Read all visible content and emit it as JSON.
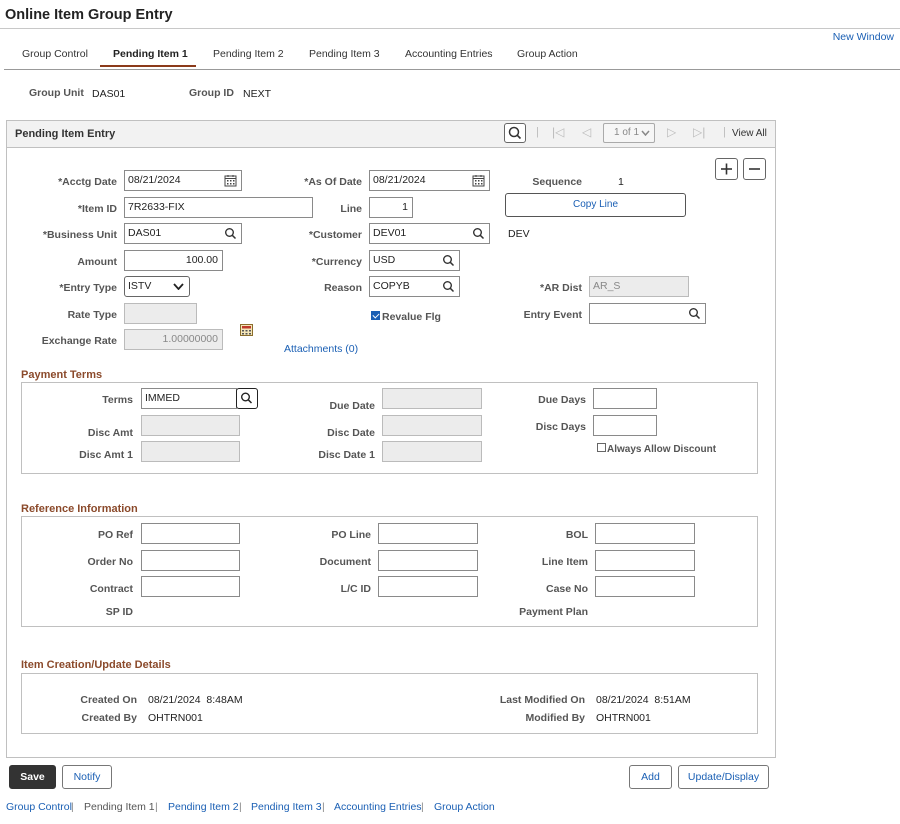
{
  "app": {
    "title": "Online Item Group Entry",
    "new_window": "New Window"
  },
  "tabs": [
    {
      "label": "Group Control"
    },
    {
      "label": "Pending Item 1"
    },
    {
      "label": "Pending Item 2"
    },
    {
      "label": "Pending Item 3"
    },
    {
      "label": "Accounting Entries"
    },
    {
      "label": "Group Action"
    }
  ],
  "header": {
    "group_unit_label": "Group Unit",
    "group_unit": "DAS01",
    "group_id_label": "Group ID",
    "group_id": "NEXT"
  },
  "pending": {
    "title": "Pending Item Entry",
    "pager": "1 of 1",
    "view_all": "View All",
    "acctg_date_label": "*Acctg Date",
    "acctg_date": "08/21/2024",
    "as_of_date_label": "*As Of Date",
    "as_of_date": "08/21/2024",
    "sequence_label": "Sequence",
    "sequence": "1",
    "item_id_label": "*Item ID",
    "item_id": "7R2633-FIX",
    "line_label": "Line",
    "line": "1",
    "copy_line": "Copy Line",
    "business_unit_label": "*Business Unit",
    "business_unit": "DAS01",
    "customer_label": "*Customer",
    "customer": "DEV01",
    "customer_name": "DEV",
    "amount_label": "Amount",
    "amount": "100.00",
    "currency_label": "*Currency",
    "currency": "USD",
    "entry_type_label": "*Entry Type",
    "entry_type": "ISTV",
    "reason_label": "Reason",
    "reason": "COPYB",
    "ar_dist_label": "*AR Dist",
    "ar_dist": "AR_S",
    "rate_type_label": "Rate Type",
    "rate_type": "",
    "revalue_flg_label": "Revalue Flg",
    "entry_event_label": "Entry Event",
    "entry_event": "",
    "exchange_rate_label": "Exchange Rate",
    "exchange_rate": "1.00000000",
    "attachments": "Attachments (0)"
  },
  "payment_terms": {
    "title": "Payment Terms",
    "terms_label": "Terms",
    "terms": "IMMED",
    "due_date_label": "Due Date",
    "due_days_label": "Due Days",
    "disc_amt_label": "Disc Amt",
    "disc_date_label": "Disc Date",
    "disc_days_label": "Disc Days",
    "disc_amt1_label": "Disc Amt 1",
    "disc_date1_label": "Disc Date 1",
    "always_allow_label": "Always Allow Discount"
  },
  "reference": {
    "title": "Reference Information",
    "po_ref_label": "PO Ref",
    "po_line_label": "PO Line",
    "bol_label": "BOL",
    "order_no_label": "Order No",
    "document_label": "Document",
    "line_item_label": "Line Item",
    "contract_label": "Contract",
    "lc_id_label": "L/C ID",
    "case_no_label": "Case No",
    "sp_id_label": "SP ID",
    "payment_plan_label": "Payment Plan"
  },
  "creation": {
    "title": "Item Creation/Update Details",
    "created_on_label": "Created On",
    "created_on": "08/21/2024  8:48AM",
    "created_by_label": "Created By",
    "created_by": "OHTRN001",
    "last_modified_label": "Last Modified On",
    "last_modified": "08/21/2024  8:51AM",
    "modified_by_label": "Modified By",
    "modified_by": "OHTRN001"
  },
  "buttons": {
    "save": "Save",
    "notify": "Notify",
    "add": "Add",
    "update_display": "Update/Display"
  },
  "footer": [
    {
      "label": "Group Control"
    },
    {
      "label": "Pending Item 1"
    },
    {
      "label": "Pending Item 2"
    },
    {
      "label": "Pending Item 3"
    },
    {
      "label": "Accounting Entries"
    },
    {
      "label": "Group Action"
    }
  ]
}
